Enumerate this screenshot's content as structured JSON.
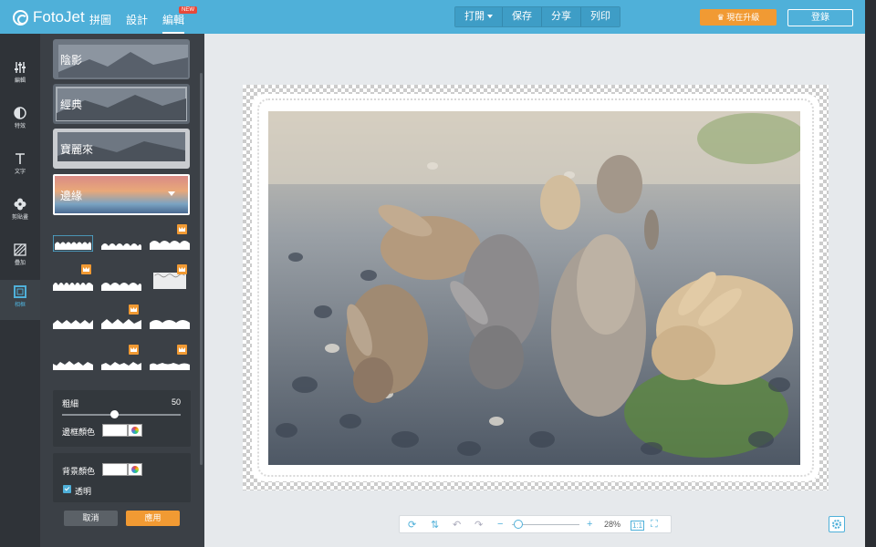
{
  "app": {
    "logo": "FotoJet"
  },
  "topnav": [
    {
      "label": "拼圖"
    },
    {
      "label": "設計"
    },
    {
      "label": "編輯",
      "badge": "NEW"
    }
  ],
  "actions": {
    "open": "打開",
    "save": "保存",
    "share": "分享",
    "print": "列印"
  },
  "upgrade_label": "現在升級",
  "login_label": "登錄",
  "rail": [
    {
      "label": "編輯",
      "icon": "sliders-icon"
    },
    {
      "label": "特效",
      "icon": "contrast-icon"
    },
    {
      "label": "文字",
      "icon": "text-icon"
    },
    {
      "label": "剪貼畫",
      "icon": "clipart-icon"
    },
    {
      "label": "疊加",
      "icon": "overlay-icon"
    },
    {
      "label": "相框",
      "icon": "frame-icon"
    }
  ],
  "effects": [
    {
      "label": "陰影"
    },
    {
      "label": "經典"
    },
    {
      "label": "寶麗來"
    }
  ],
  "selected_effect": "邊緣",
  "controls": {
    "thickness_label": "粗細",
    "thickness_value": "50",
    "thickness_level": 0.5,
    "border_color_label": "邊框顏色",
    "bg_color_label": "背景顏色",
    "transparent_label": "透明",
    "cancel_label": "取消",
    "apply_label": "應用"
  },
  "zoom": {
    "percent": "28%"
  },
  "colors": {
    "brand": "#4fb0d9",
    "accent": "#f19a33",
    "rail": "#2f3338",
    "panel": "#3b4046"
  }
}
